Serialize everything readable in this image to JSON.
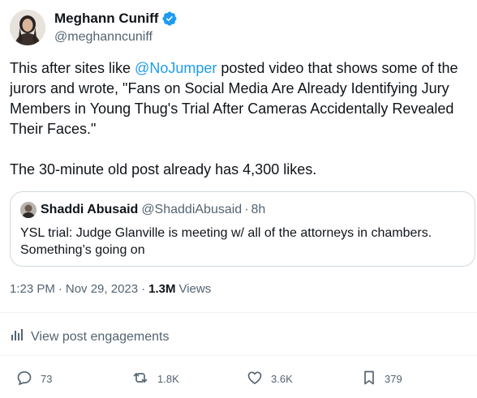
{
  "author": {
    "name": "Meghann Cuniff",
    "handle": "@meghanncuniff",
    "verified_color": "#1d9bf0"
  },
  "post": {
    "text_before_mention": "This after sites like ",
    "mention": "@NoJumper",
    "text_after_mention": " posted video that shows some of the jurors and wrote, \"Fans on Social Media Are Already Identifying Jury Members in Young Thug's Trial After Cameras Accidentally Revealed Their Faces.\"",
    "text_second": "The 30-minute old post already has 4,300 likes."
  },
  "quoted": {
    "name": "Shaddi Abusaid",
    "handle": "@ShaddiAbusaid",
    "dot": "·",
    "time": "8h",
    "text": "YSL trial: Judge Glanville is meeting w/ all of the attorneys in chambers. Something’s going on"
  },
  "meta": {
    "time": "1:23 PM",
    "sep1": "·",
    "date": "Nov 29, 2023",
    "sep2": "·",
    "views_count": "1.3M",
    "views_label": "Views"
  },
  "engagements_label": "View post engagements",
  "actions": {
    "replies": "73",
    "reposts": "1.8K",
    "likes": "3.6K",
    "bookmarks": "379"
  },
  "colors": {
    "accent": "#1d9bf0",
    "text": "#0f1419",
    "muted": "#536471",
    "border": "#cfd9de"
  },
  "icons": [
    "verified-badge-icon",
    "analytics-icon",
    "reply-icon",
    "repost-icon",
    "like-icon",
    "bookmark-icon"
  ]
}
